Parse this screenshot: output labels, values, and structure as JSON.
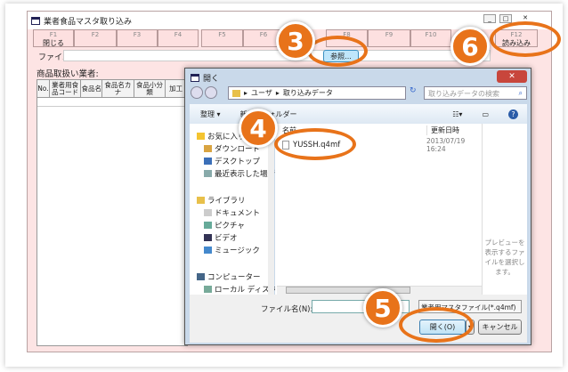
{
  "window": {
    "title": "業者食品マスタ取り込み",
    "file_label": "ファイル",
    "browse": "参照...",
    "vendor_label": "商品取扱い業者:"
  },
  "fkeys": [
    {
      "key": "F1",
      "label": "閉じる"
    },
    {
      "key": "F2",
      "label": ""
    },
    {
      "key": "F3",
      "label": ""
    },
    {
      "key": "F4",
      "label": ""
    },
    {
      "key": "F5",
      "label": ""
    },
    {
      "key": "F6",
      "label": ""
    },
    {
      "key": "F8",
      "label": ""
    },
    {
      "key": "F9",
      "label": ""
    },
    {
      "key": "F10",
      "label": ""
    },
    {
      "key": "F12",
      "label": "読み込み"
    }
  ],
  "grid_headers": [
    "No.",
    "業者用食品コード",
    "食品名",
    "食品名カナ",
    "食品小分類",
    "加工"
  ],
  "dialog": {
    "title": "開く",
    "path": [
      "ユーザ",
      "取り込みデータ"
    ],
    "search_placeholder": "取り込みデータの検索",
    "organize": "整理 ▾",
    "new_folder": "新しいフォルダー",
    "nav": [
      "お気に入り",
      "ダウンロード",
      "デスクトップ",
      "最近表示した場所",
      "ライブラリ",
      "ドキュメント",
      "ピクチャ",
      "ビデオ",
      "ミュージック",
      "コンピューター",
      "ローカル ディスク"
    ],
    "col_name": "名前",
    "col_date": "更新日時",
    "files": [
      {
        "name": "YUSSH.q4mf",
        "date": "2013/07/19 16:24"
      }
    ],
    "preview": "プレビューを表示するファイルを選択します。",
    "filename_label": "ファイル名(N):",
    "filename_value": "",
    "filetype": "業者用マスタファイル(*.q4mf)",
    "open": "開く(O)",
    "cancel": "キャンセル"
  },
  "callouts": [
    "3",
    "4",
    "5",
    "6"
  ],
  "colors": {
    "accent": "#e8731a",
    "window_bg": "#fde4e4"
  }
}
